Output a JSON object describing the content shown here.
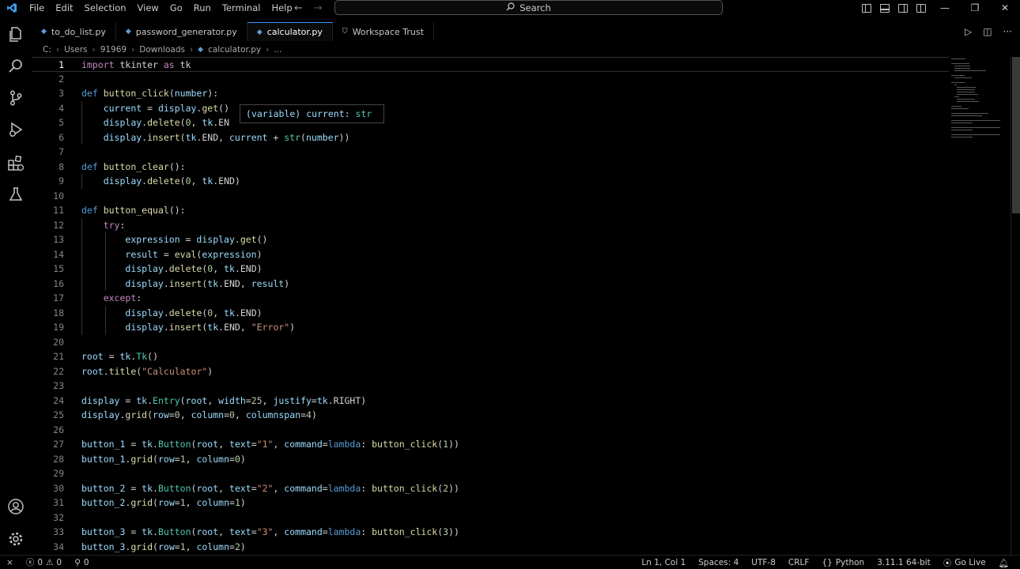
{
  "titlebar": {
    "menu": [
      "File",
      "Edit",
      "Selection",
      "View",
      "Go",
      "Run",
      "Terminal",
      "Help"
    ],
    "search_label": "Search"
  },
  "tabs": [
    {
      "label": "to_do_list.py",
      "active": false
    },
    {
      "label": "password_generator.py",
      "active": false
    },
    {
      "label": "calculator.py",
      "active": true
    },
    {
      "label": "Workspace Trust",
      "active": false
    }
  ],
  "breadcrumb": [
    "C:",
    "Users",
    "91969",
    "Downloads",
    "calculator.py",
    "..."
  ],
  "editor": {
    "current_line": 1,
    "lines": [
      {
        "n": 1,
        "tokens": [
          [
            "kw",
            "import"
          ],
          [
            "",
            " tkinter "
          ],
          [
            "kw",
            "as"
          ],
          [
            "",
            " tk"
          ]
        ]
      },
      {
        "n": 2,
        "tokens": []
      },
      {
        "n": 3,
        "tokens": [
          [
            "kw2",
            "def"
          ],
          [
            "",
            " "
          ],
          [
            "fn",
            "button_click"
          ],
          [
            "",
            "("
          ],
          [
            "var",
            "number"
          ],
          [
            "",
            "):"
          ]
        ]
      },
      {
        "n": 4,
        "tokens": [
          [
            "",
            "    "
          ],
          [
            "var",
            "current"
          ],
          [
            "",
            " = "
          ],
          [
            "var",
            "display"
          ],
          [
            "",
            "."
          ],
          [
            "fn",
            "get"
          ],
          [
            "",
            "()"
          ]
        ]
      },
      {
        "n": 5,
        "tokens": [
          [
            "",
            "    "
          ],
          [
            "var",
            "display"
          ],
          [
            "",
            "."
          ],
          [
            "fn",
            "delete"
          ],
          [
            "",
            "("
          ],
          [
            "num",
            "0"
          ],
          [
            "",
            ", "
          ],
          [
            "var",
            "tk"
          ],
          [
            "",
            ".EN"
          ]
        ]
      },
      {
        "n": 6,
        "tokens": [
          [
            "",
            "    "
          ],
          [
            "var",
            "display"
          ],
          [
            "",
            "."
          ],
          [
            "fn",
            "insert"
          ],
          [
            "",
            "("
          ],
          [
            "var",
            "tk"
          ],
          [
            "",
            ".END, "
          ],
          [
            "var",
            "current"
          ],
          [
            "",
            " + "
          ],
          [
            "cls",
            "str"
          ],
          [
            "",
            "("
          ],
          [
            "var",
            "number"
          ],
          [
            "",
            "))"
          ]
        ]
      },
      {
        "n": 7,
        "tokens": []
      },
      {
        "n": 8,
        "tokens": [
          [
            "kw2",
            "def"
          ],
          [
            "",
            " "
          ],
          [
            "fn",
            "button_clear"
          ],
          [
            "",
            "():"
          ]
        ]
      },
      {
        "n": 9,
        "tokens": [
          [
            "",
            "    "
          ],
          [
            "var",
            "display"
          ],
          [
            "",
            "."
          ],
          [
            "fn",
            "delete"
          ],
          [
            "",
            "("
          ],
          [
            "num",
            "0"
          ],
          [
            "",
            ", "
          ],
          [
            "var",
            "tk"
          ],
          [
            "",
            ".END)"
          ]
        ]
      },
      {
        "n": 10,
        "tokens": []
      },
      {
        "n": 11,
        "tokens": [
          [
            "kw2",
            "def"
          ],
          [
            "",
            " "
          ],
          [
            "fn",
            "button_equal"
          ],
          [
            "",
            "():"
          ]
        ]
      },
      {
        "n": 12,
        "tokens": [
          [
            "",
            "    "
          ],
          [
            "kw",
            "try"
          ],
          [
            "",
            ":"
          ]
        ]
      },
      {
        "n": 13,
        "tokens": [
          [
            "",
            "        "
          ],
          [
            "var",
            "expression"
          ],
          [
            "",
            " = "
          ],
          [
            "var",
            "display"
          ],
          [
            "",
            "."
          ],
          [
            "fn",
            "get"
          ],
          [
            "",
            "()"
          ]
        ]
      },
      {
        "n": 14,
        "tokens": [
          [
            "",
            "        "
          ],
          [
            "var",
            "result"
          ],
          [
            "",
            " = "
          ],
          [
            "fn",
            "eval"
          ],
          [
            "",
            "("
          ],
          [
            "var",
            "expression"
          ],
          [
            "",
            ")"
          ]
        ]
      },
      {
        "n": 15,
        "tokens": [
          [
            "",
            "        "
          ],
          [
            "var",
            "display"
          ],
          [
            "",
            "."
          ],
          [
            "fn",
            "delete"
          ],
          [
            "",
            "("
          ],
          [
            "num",
            "0"
          ],
          [
            "",
            ", "
          ],
          [
            "var",
            "tk"
          ],
          [
            "",
            ".END)"
          ]
        ]
      },
      {
        "n": 16,
        "tokens": [
          [
            "",
            "        "
          ],
          [
            "var",
            "display"
          ],
          [
            "",
            "."
          ],
          [
            "fn",
            "insert"
          ],
          [
            "",
            "("
          ],
          [
            "var",
            "tk"
          ],
          [
            "",
            ".END, "
          ],
          [
            "var",
            "result"
          ],
          [
            "",
            ")"
          ]
        ]
      },
      {
        "n": 17,
        "tokens": [
          [
            "",
            "    "
          ],
          [
            "kw",
            "except"
          ],
          [
            "",
            ":"
          ]
        ]
      },
      {
        "n": 18,
        "tokens": [
          [
            "",
            "        "
          ],
          [
            "var",
            "display"
          ],
          [
            "",
            "."
          ],
          [
            "fn",
            "delete"
          ],
          [
            "",
            "("
          ],
          [
            "num",
            "0"
          ],
          [
            "",
            ", "
          ],
          [
            "var",
            "tk"
          ],
          [
            "",
            ".END)"
          ]
        ]
      },
      {
        "n": 19,
        "tokens": [
          [
            "",
            "        "
          ],
          [
            "var",
            "display"
          ],
          [
            "",
            "."
          ],
          [
            "fn",
            "insert"
          ],
          [
            "",
            "("
          ],
          [
            "var",
            "tk"
          ],
          [
            "",
            ".END, "
          ],
          [
            "str",
            "\"Error\""
          ],
          [
            "",
            ")"
          ]
        ]
      },
      {
        "n": 20,
        "tokens": []
      },
      {
        "n": 21,
        "tokens": [
          [
            "var",
            "root"
          ],
          [
            "",
            " = "
          ],
          [
            "var",
            "tk"
          ],
          [
            "",
            "."
          ],
          [
            "cls",
            "Tk"
          ],
          [
            "",
            "()"
          ]
        ]
      },
      {
        "n": 22,
        "tokens": [
          [
            "var",
            "root"
          ],
          [
            "",
            "."
          ],
          [
            "fn",
            "title"
          ],
          [
            "",
            "("
          ],
          [
            "str",
            "\"Calculator\""
          ],
          [
            "",
            ")"
          ]
        ]
      },
      {
        "n": 23,
        "tokens": []
      },
      {
        "n": 24,
        "tokens": [
          [
            "var",
            "display"
          ],
          [
            "",
            " = "
          ],
          [
            "var",
            "tk"
          ],
          [
            "",
            "."
          ],
          [
            "cls",
            "Entry"
          ],
          [
            "",
            "("
          ],
          [
            "var",
            "root"
          ],
          [
            "",
            ", "
          ],
          [
            "var",
            "width"
          ],
          [
            "",
            "="
          ],
          [
            "num",
            "25"
          ],
          [
            "",
            ", "
          ],
          [
            "var",
            "justify"
          ],
          [
            "",
            "="
          ],
          [
            "var",
            "tk"
          ],
          [
            "",
            ".RIGHT)"
          ]
        ]
      },
      {
        "n": 25,
        "tokens": [
          [
            "var",
            "display"
          ],
          [
            "",
            "."
          ],
          [
            "fn",
            "grid"
          ],
          [
            "",
            "("
          ],
          [
            "var",
            "row"
          ],
          [
            "",
            "="
          ],
          [
            "num",
            "0"
          ],
          [
            "",
            ", "
          ],
          [
            "var",
            "column"
          ],
          [
            "",
            "="
          ],
          [
            "num",
            "0"
          ],
          [
            "",
            ", "
          ],
          [
            "var",
            "columnspan"
          ],
          [
            "",
            "="
          ],
          [
            "num",
            "4"
          ],
          [
            "",
            ")"
          ]
        ]
      },
      {
        "n": 26,
        "tokens": []
      },
      {
        "n": 27,
        "tokens": [
          [
            "var",
            "button_1"
          ],
          [
            "",
            " = "
          ],
          [
            "var",
            "tk"
          ],
          [
            "",
            "."
          ],
          [
            "cls",
            "Button"
          ],
          [
            "",
            "("
          ],
          [
            "var",
            "root"
          ],
          [
            "",
            ", "
          ],
          [
            "var",
            "text"
          ],
          [
            "",
            "="
          ],
          [
            "str",
            "\"1\""
          ],
          [
            "",
            ", "
          ],
          [
            "var",
            "command"
          ],
          [
            "",
            "="
          ],
          [
            "kw2",
            "lambda"
          ],
          [
            "",
            ": "
          ],
          [
            "fn",
            "button_click"
          ],
          [
            "",
            "("
          ],
          [
            "num",
            "1"
          ],
          [
            "",
            "))"
          ]
        ]
      },
      {
        "n": 28,
        "tokens": [
          [
            "var",
            "button_1"
          ],
          [
            "",
            "."
          ],
          [
            "fn",
            "grid"
          ],
          [
            "",
            "("
          ],
          [
            "var",
            "row"
          ],
          [
            "",
            "="
          ],
          [
            "num",
            "1"
          ],
          [
            "",
            ", "
          ],
          [
            "var",
            "column"
          ],
          [
            "",
            "="
          ],
          [
            "num",
            "0"
          ],
          [
            "",
            ")"
          ]
        ]
      },
      {
        "n": 29,
        "tokens": []
      },
      {
        "n": 30,
        "tokens": [
          [
            "var",
            "button_2"
          ],
          [
            "",
            " = "
          ],
          [
            "var",
            "tk"
          ],
          [
            "",
            "."
          ],
          [
            "cls",
            "Button"
          ],
          [
            "",
            "("
          ],
          [
            "var",
            "root"
          ],
          [
            "",
            ", "
          ],
          [
            "var",
            "text"
          ],
          [
            "",
            "="
          ],
          [
            "str",
            "\"2\""
          ],
          [
            "",
            ", "
          ],
          [
            "var",
            "command"
          ],
          [
            "",
            "="
          ],
          [
            "kw2",
            "lambda"
          ],
          [
            "",
            ": "
          ],
          [
            "fn",
            "button_click"
          ],
          [
            "",
            "("
          ],
          [
            "num",
            "2"
          ],
          [
            "",
            "))"
          ]
        ]
      },
      {
        "n": 31,
        "tokens": [
          [
            "var",
            "button_2"
          ],
          [
            "",
            "."
          ],
          [
            "fn",
            "grid"
          ],
          [
            "",
            "("
          ],
          [
            "var",
            "row"
          ],
          [
            "",
            "="
          ],
          [
            "num",
            "1"
          ],
          [
            "",
            ", "
          ],
          [
            "var",
            "column"
          ],
          [
            "",
            "="
          ],
          [
            "num",
            "1"
          ],
          [
            "",
            ")"
          ]
        ]
      },
      {
        "n": 32,
        "tokens": []
      },
      {
        "n": 33,
        "tokens": [
          [
            "var",
            "button_3"
          ],
          [
            "",
            " = "
          ],
          [
            "var",
            "tk"
          ],
          [
            "",
            "."
          ],
          [
            "cls",
            "Button"
          ],
          [
            "",
            "("
          ],
          [
            "var",
            "root"
          ],
          [
            "",
            ", "
          ],
          [
            "var",
            "text"
          ],
          [
            "",
            "="
          ],
          [
            "str",
            "\"3\""
          ],
          [
            "",
            ", "
          ],
          [
            "var",
            "command"
          ],
          [
            "",
            "="
          ],
          [
            "kw2",
            "lambda"
          ],
          [
            "",
            ": "
          ],
          [
            "fn",
            "button_click"
          ],
          [
            "",
            "("
          ],
          [
            "num",
            "3"
          ],
          [
            "",
            "))"
          ]
        ]
      },
      {
        "n": 34,
        "tokens": [
          [
            "var",
            "button_3"
          ],
          [
            "",
            "."
          ],
          [
            "fn",
            "grid"
          ],
          [
            "",
            "("
          ],
          [
            "var",
            "row"
          ],
          [
            "",
            "="
          ],
          [
            "num",
            "1"
          ],
          [
            "",
            ", "
          ],
          [
            "var",
            "column"
          ],
          [
            "",
            "="
          ],
          [
            "num",
            "2"
          ],
          [
            "",
            ")"
          ]
        ]
      }
    ]
  },
  "hover": {
    "kind": "(variable)",
    "name": "current:",
    "type": "str"
  },
  "statusbar": {
    "errors": "0",
    "warnings": "0",
    "ports": "0",
    "position": "Ln 1, Col 1",
    "spaces": "Spaces: 4",
    "encoding": "UTF-8",
    "eol": "CRLF",
    "language": "Python",
    "interpreter": "3.11.1 64-bit",
    "golive": "Go Live"
  },
  "colors": {
    "accent": "#3794ff",
    "background": "#000000",
    "keyword": "#c586c0",
    "function": "#dcdcaa",
    "variable": "#9cdcfe",
    "string": "#ce9178",
    "number": "#b5cea8"
  }
}
